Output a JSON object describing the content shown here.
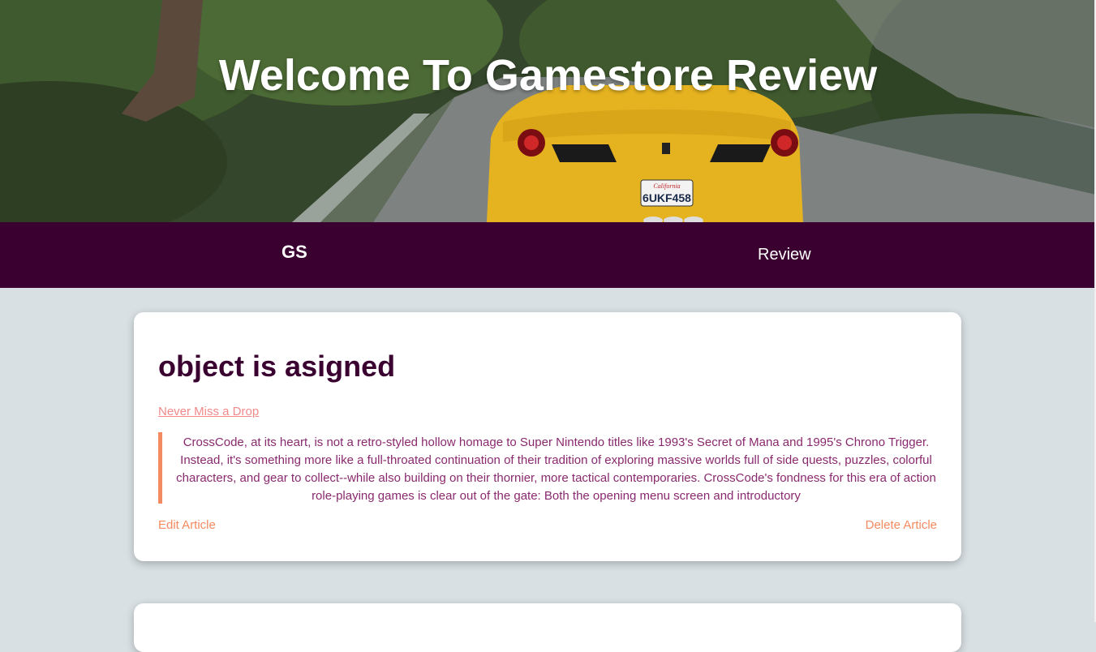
{
  "hero": {
    "title": "Welcome To Gamestore Review",
    "license_plate_state": "California",
    "license_plate_number": "6UKF458"
  },
  "nav": {
    "brand": "GS",
    "link": "Review"
  },
  "articles": [
    {
      "title": "object is asigned",
      "link_label": "Never Miss a Drop",
      "body": "CrossCode, at its heart, is not a retro-styled hollow homage to Super Nintendo titles like 1993's Secret of Mana and 1995's Chrono Trigger. Instead, it's something more like a full-throated continuation of their tradition of exploring massive worlds full of side quests, puzzles, colorful characters, and gear to collect--while also building on their thornier, more tactical contemporaries. CrossCode's fondness for this era of action role-playing games is clear out of the gate: Both the opening menu screen and introductory",
      "edit_label": "Edit Article",
      "delete_label": "Delete Article"
    }
  ],
  "colors": {
    "nav_bg": "#3a0030",
    "page_bg": "#d8e0e4",
    "accent": "#f48a5f",
    "title": "#3a0030",
    "body_text": "#8a2a6e",
    "link": "#f08a8a"
  }
}
